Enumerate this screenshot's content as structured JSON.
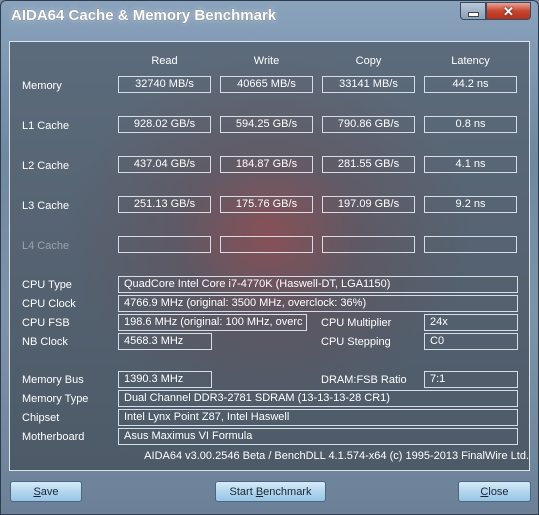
{
  "window": {
    "title": "AIDA64 Cache & Memory Benchmark"
  },
  "columns": {
    "read": "Read",
    "write": "Write",
    "copy": "Copy",
    "latency": "Latency"
  },
  "rows": {
    "memory": {
      "label": "Memory",
      "read": "32740 MB/s",
      "write": "40665 MB/s",
      "copy": "33141 MB/s",
      "latency": "44.2 ns"
    },
    "l1": {
      "label": "L1 Cache",
      "read": "928.02 GB/s",
      "write": "594.25 GB/s",
      "copy": "790.86 GB/s",
      "latency": "0.8 ns"
    },
    "l2": {
      "label": "L2 Cache",
      "read": "437.04 GB/s",
      "write": "184.87 GB/s",
      "copy": "281.55 GB/s",
      "latency": "4.1 ns"
    },
    "l3": {
      "label": "L3 Cache",
      "read": "251.13 GB/s",
      "write": "175.76 GB/s",
      "copy": "197.09 GB/s",
      "latency": "9.2 ns"
    },
    "l4": {
      "label": "L4 Cache",
      "read": "",
      "write": "",
      "copy": "",
      "latency": ""
    }
  },
  "info": {
    "cpu_type_label": "CPU Type",
    "cpu_type": "QuadCore Intel Core i7-4770K  (Haswell-DT, LGA1150)",
    "cpu_clock_label": "CPU Clock",
    "cpu_clock": "4766.9 MHz  (original: 3500 MHz, overclock: 36%)",
    "cpu_fsb_label": "CPU FSB",
    "cpu_fsb": "198.6 MHz  (original: 100 MHz, overc",
    "cpu_multiplier_label": "CPU Multiplier",
    "cpu_multiplier": "24x",
    "nb_clock_label": "NB Clock",
    "nb_clock": "4568.3 MHz",
    "cpu_stepping_label": "CPU Stepping",
    "cpu_stepping": "C0",
    "memory_bus_label": "Memory Bus",
    "memory_bus": "1390.3 MHz",
    "dram_fsb_label": "DRAM:FSB Ratio",
    "dram_fsb": "7:1",
    "memory_type_label": "Memory Type",
    "memory_type": "Dual Channel DDR3-2781 SDRAM  (13-13-13-28 CR1)",
    "chipset_label": "Chipset",
    "chipset": "Intel Lynx Point Z87, Intel Haswell",
    "motherboard_label": "Motherboard",
    "motherboard": "Asus Maximus VI Formula"
  },
  "footer": {
    "version": "AIDA64 v3.00.2546 Beta / BenchDLL 4.1.574-x64  (c) 1995-2013 FinalWire Ltd."
  },
  "buttons": {
    "save_first": "S",
    "save_rest": "ave",
    "start_pre": "Start ",
    "start_ul": "B",
    "start_post": "enchmark",
    "close_first": "C",
    "close_rest": "lose"
  },
  "icons": {
    "minimize": "minimize-icon",
    "close": "close-icon"
  },
  "colors": {
    "panel": "#56636f",
    "button": "#b3d6ee",
    "close_button": "#c8452f"
  }
}
